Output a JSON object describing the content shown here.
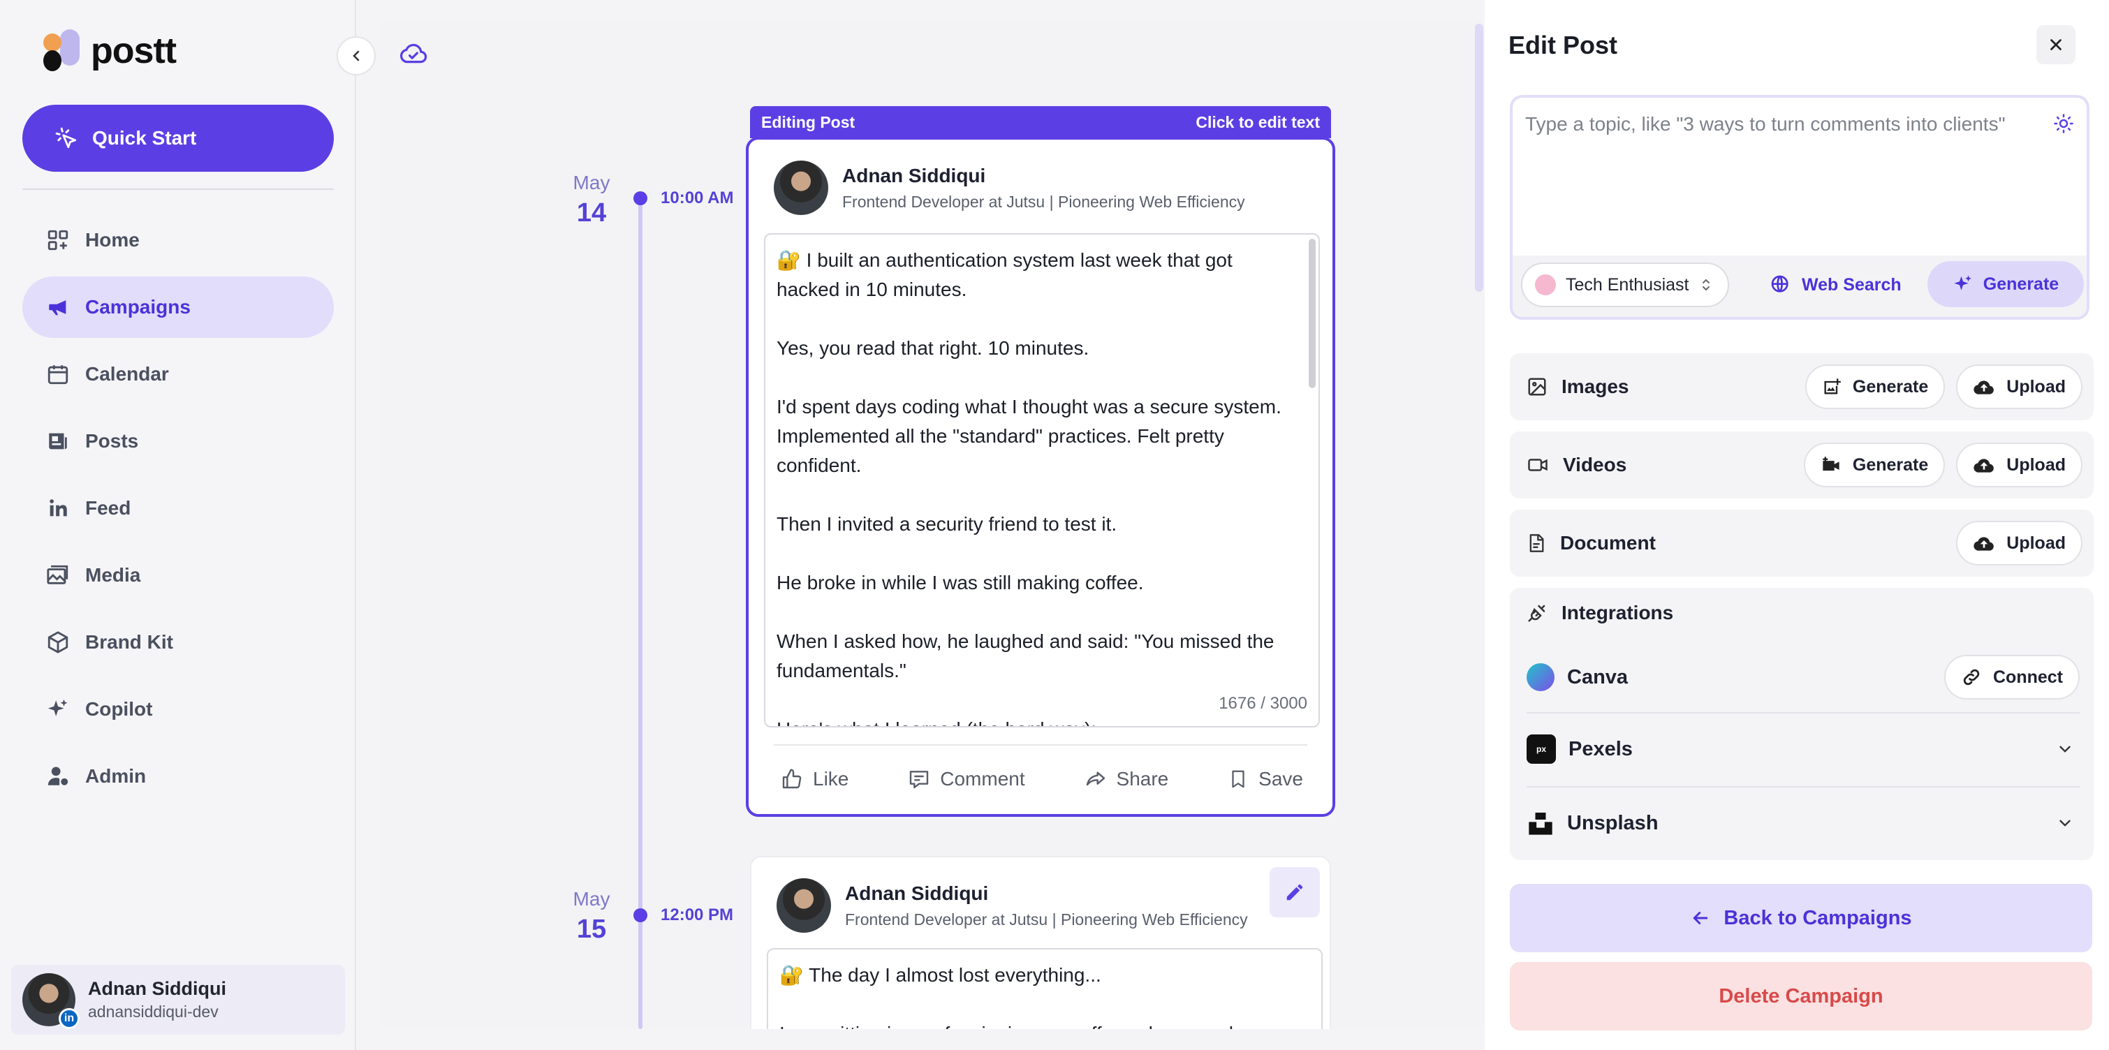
{
  "sidebar": {
    "logo_text": "postt",
    "quick_start": "Quick Start",
    "nav": [
      {
        "label": "Home",
        "icon": "grid-icon"
      },
      {
        "label": "Campaigns",
        "icon": "megaphone-icon",
        "active": true
      },
      {
        "label": "Calendar",
        "icon": "calendar-icon"
      },
      {
        "label": "Posts",
        "icon": "newspaper-icon"
      },
      {
        "label": "Feed",
        "icon": "linkedin-icon"
      },
      {
        "label": "Media",
        "icon": "images-icon"
      },
      {
        "label": "Brand Kit",
        "icon": "box-icon"
      },
      {
        "label": "Copilot",
        "icon": "sparkles-icon"
      },
      {
        "label": "Admin",
        "icon": "user-gear-icon"
      }
    ],
    "profile": {
      "name": "Adnan Siddiqui",
      "handle": "adnansiddiqui-dev",
      "badge": "in"
    }
  },
  "timeline": {
    "entries": [
      {
        "month": "May",
        "day": "14",
        "time": "10:00 AM"
      },
      {
        "month": "May",
        "day": "15",
        "time": "12:00 PM"
      }
    ]
  },
  "editing_post": {
    "banner_left": "Editing Post",
    "banner_right": "Click to edit text",
    "author": "Adnan Siddiqui",
    "headline": "Frontend Developer at Jutsu | Pioneering Web Efficiency",
    "paragraphs": [
      "🔐 I built an authentication system last week that got hacked in 10 minutes.",
      "Yes, you read that right. 10 minutes.",
      "I'd spent days coding what I thought was a secure system. Implemented all the \"standard\" practices. Felt pretty confident.",
      "Then I invited a security friend to test it.",
      "He broke in while I was still making coffee.",
      "When I asked how, he laughed and said: \"You missed the fundamentals.\"",
      "Here's what I learned (the hard way):"
    ],
    "char_count": "1676 / 3000",
    "actions": [
      "Like",
      "Comment",
      "Share",
      "Save"
    ]
  },
  "next_post": {
    "author": "Adnan Siddiqui",
    "headline": "Frontend Developer at Jutsu | Pioneering Web Efficiency",
    "paragraphs": [
      "🔐 The day I almost lost everything...",
      "I was sitting in a cafe, sipping my coffee, when my phone"
    ]
  },
  "panel": {
    "title": "Edit Post",
    "composer_placeholder": "Type a topic, like \"3 ways to turn comments into clients\"",
    "persona": "Tech Enthusiast",
    "web_search": "Web Search",
    "generate": "Generate",
    "media": [
      {
        "label": "Images",
        "buttons": [
          "Generate",
          "Upload"
        ]
      },
      {
        "label": "Videos",
        "buttons": [
          "Generate",
          "Upload"
        ]
      },
      {
        "label": "Document",
        "buttons": [
          "Upload"
        ]
      }
    ],
    "integrations": {
      "title": "Integrations",
      "items": [
        {
          "name": "Canva",
          "action": "Connect"
        },
        {
          "name": "Pexels"
        },
        {
          "name": "Unsplash"
        }
      ]
    },
    "back": "Back to Campaigns",
    "delete": "Delete Campaign"
  },
  "colors": {
    "accent": "#5b3fe4",
    "accent_light": "#e1ddfa",
    "danger": "#d84a4a",
    "danger_bg": "#fbe1e1"
  }
}
